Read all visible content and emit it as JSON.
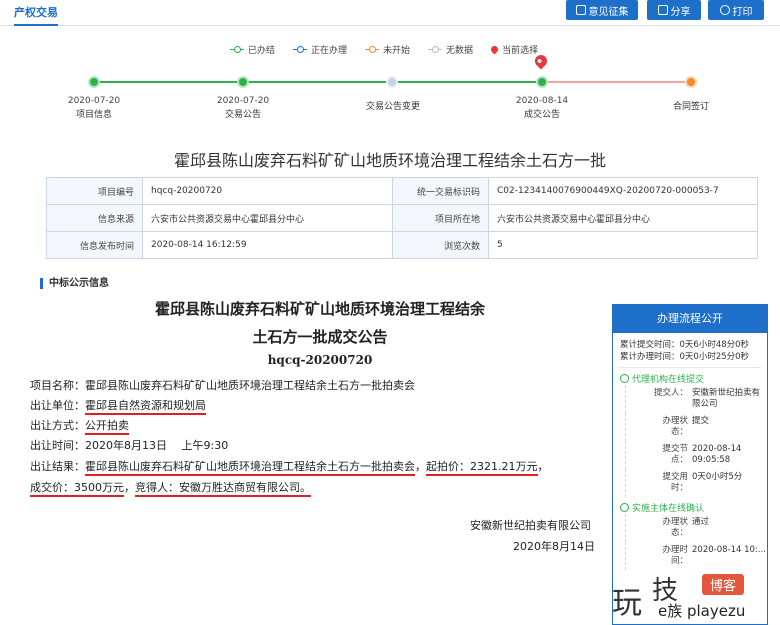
{
  "header": {
    "tab": "产权交易",
    "buttons": [
      "意见征集",
      "分享",
      "打印"
    ]
  },
  "legend": [
    {
      "label": "已办结",
      "color": "#2eb04b"
    },
    {
      "label": "正在办理",
      "color": "#1e6fc9"
    },
    {
      "label": "未开始",
      "color": "#f08a2b"
    },
    {
      "label": "无数据",
      "color": "#a9bcd8"
    },
    {
      "label": "当前选择",
      "color": "#e8373a"
    }
  ],
  "steps": [
    {
      "date": "2020-07-20",
      "label": "项目信息"
    },
    {
      "date": "2020-07-20",
      "label": "交易公告"
    },
    {
      "date": "",
      "label": "交易公告变更"
    },
    {
      "date": "2020-08-14",
      "label": "成交公告"
    },
    {
      "date": "",
      "label": "合同签订"
    }
  ],
  "title": "霍邱县陈山废弃石料矿矿山地质环境治理工程结余土石方一批",
  "info_table": {
    "r1": {
      "k1": "项目编号",
      "v1": "hqcq-20200720",
      "k2": "统一交易标识码",
      "v2": "C02-1234140076900449XQ-20200720-000053-7"
    },
    "r2": {
      "k1": "信息来源",
      "v1": "六安市公共资源交易中心霍邱县分中心",
      "k2": "项目所在地",
      "v2": "六安市公共资源交易中心霍邱县分中心"
    },
    "r3": {
      "k1": "信息发布时间",
      "v1": "2020-08-14 16:12:59",
      "k2": "浏览次数",
      "v2": "5"
    }
  },
  "section_title": "中标公示信息",
  "announcement": {
    "title_line1": "霍邱县陈山废弃石料矿矿山地质环境治理工程结余",
    "title_line2": "土石方一批成交公告",
    "code": "hqcq-20200720",
    "project_label": "项目名称：",
    "project": "霍邱县陈山废弃石料矿矿山地质环境治理工程结余土石方一批拍卖会",
    "unit_label": "出让单位：",
    "unit": "霍邱县自然资源和规划局",
    "method_label": "出让方式：",
    "method": "公开拍卖",
    "time_label": "出让时间：",
    "time": "2020年8月13日　 上午9:30",
    "result_label": "出让结果：",
    "result_project": "霍邱县陈山废弃石料矿矿山地质环境治理工程结余土石方一批拍卖会",
    "comma1": "，",
    "start_price": "起拍价：2321.21万元",
    "comma2": "，",
    "deal_price": "成交价：3500万元",
    "comma3": "，",
    "buyer": "竞得人：安徽万胜达商贸有限公司。",
    "sign_company": "安徽新世纪拍卖有限公司",
    "sign_date": "2020年8月14日"
  },
  "panel": {
    "title": "办理流程公开",
    "total_submit_label": "累计提交时间：",
    "total_submit": "0天6小时48分0秒",
    "total_handle_label": "累计办理时间：",
    "total_handle": "0天0小时25分0秒",
    "sec1": "代理机构在线提交",
    "sec1_rows": [
      {
        "k": "提交人：",
        "v": "安徽新世纪拍卖有限公司"
      },
      {
        "k": "办理状态：",
        "v": "提交"
      },
      {
        "k": "提交节点：",
        "v": "2020-08-14 09:05:58"
      },
      {
        "k": "提交用时：",
        "v": "0天0小时5分"
      }
    ],
    "sec2": "实施主体在线确认",
    "sec2_rows": [
      {
        "k": "办理状态：",
        "v": "通过"
      },
      {
        "k": "办理时间：",
        "v": "2020-08-14 10:..."
      }
    ]
  },
  "watermark": {
    "char1": "玩",
    "char2": "技",
    "tag": "博客",
    "domain": "e族 playezu"
  }
}
